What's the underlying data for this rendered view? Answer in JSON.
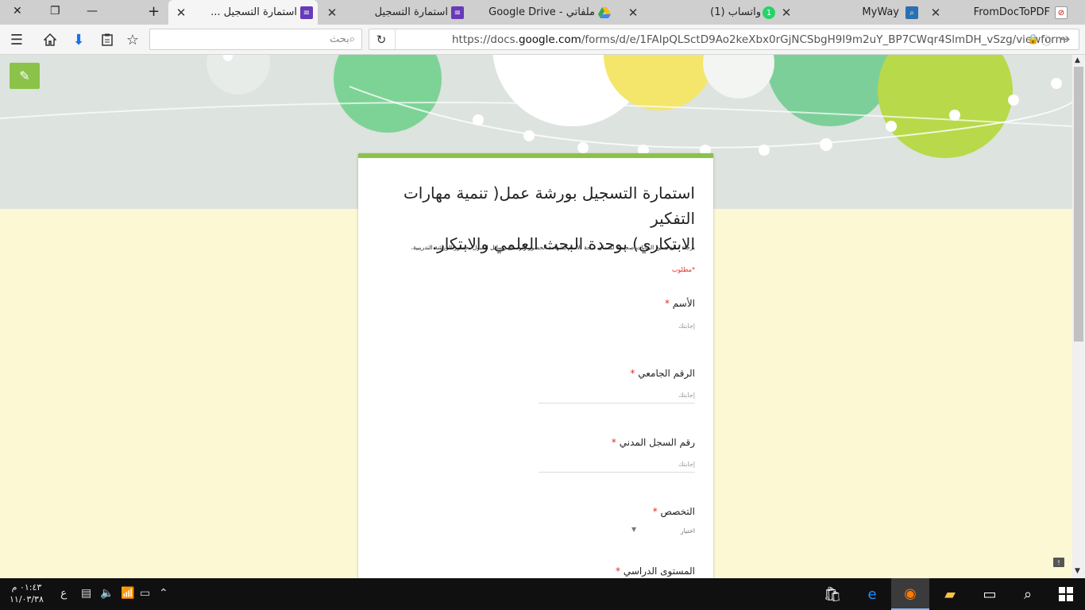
{
  "browser": {
    "tabs": [
      {
        "title": "FromDocToPDF",
        "icon": "fromdoctopdf-icon",
        "active": false
      },
      {
        "title": "MyWay",
        "icon": "myway-search-icon",
        "active": false
      },
      {
        "title": "واتساب (1)",
        "icon": "whatsapp-badge-icon",
        "badge": "1",
        "active": false
      },
      {
        "title": "ملفاتي - Google Drive",
        "icon": "google-drive-icon",
        "active": false
      },
      {
        "title": "استمارة التسجيل",
        "icon": "google-forms-icon",
        "active": false
      },
      {
        "title": "استمارة التسجيل ...",
        "icon": "google-forms-icon",
        "active": true
      }
    ],
    "search_placeholder": "بحث",
    "url_prefix": "https://docs.",
    "url_domain": "google.com",
    "url_path": "/forms/d/e/1FAIpQLSctD9Ao2keXbx0rGjNCSbgH9I9m2uY_BP7CWqr4SlmDH_vSzg/viewform"
  },
  "form": {
    "title_line1": "استمارة التسجيل بورشة عمل( تنمية مهارات التفكير",
    "title_line2": "الابتكاري) بوحدة البحث العلمي والابتكار.",
    "description": "برجاء ملئ جميع البيانات صحيحة لضمان صحة الأسم بشهادة الحضور وارسال رسائل القبول بحضور الورشة التدريبية.",
    "required_note": "*مطلوب",
    "questions": [
      {
        "label": "الأسم",
        "star": "*",
        "placeholder": "إجابتك"
      },
      {
        "label": "الرقم الجامعي",
        "star": "*",
        "placeholder": "إجابتك"
      },
      {
        "label": "رقم السجل المدني",
        "star": "*",
        "placeholder": "إجابتك"
      },
      {
        "label": "التخصص",
        "star": "*",
        "select": "اختيار"
      },
      {
        "label": "المستوى الدراسي",
        "star": "*"
      }
    ]
  },
  "taskbar": {
    "time": "٠١:٤٣ م",
    "date": "١١/٠٣/٣٨",
    "lang": "ع"
  },
  "colors": {
    "accent": "#8bc34a",
    "required": "#d93025",
    "page_bg": "#fdf8d4"
  }
}
